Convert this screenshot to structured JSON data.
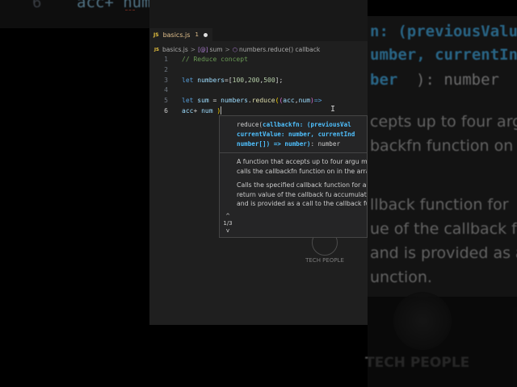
{
  "background": {
    "top_left_fragment": "acc+ num",
    "top_left_digit": "6",
    "top_right_fragment": "n: (previousValu",
    "line2": "umber, currentInd",
    "line3_param": "ber",
    "line3_rest": "): number",
    "prose": [
      "cepts up to four argu",
      "backfn function on",
      "llback function for",
      "ue of the callback fu",
      "and is provided as a",
      "unction."
    ],
    "brand": "TECH PEOPLE"
  },
  "tab": {
    "badge": "JS",
    "filename": "basics.js",
    "problem_count": "1"
  },
  "breadcrumb": {
    "file_badge": "JS",
    "file": "basics.js",
    "symbol_glyph": "[@]",
    "symbol": "sum",
    "method": "numbers.reduce() callback"
  },
  "code_lines": [
    {
      "n": "1",
      "parts": [
        {
          "c": "cm",
          "t": "// Reduce concept"
        }
      ]
    },
    {
      "n": "2",
      "parts": []
    },
    {
      "n": "3",
      "parts": [
        {
          "c": "kw",
          "t": "let "
        },
        {
          "c": "var",
          "t": "numbers"
        },
        {
          "c": "pl",
          "t": "=["
        },
        {
          "c": "num",
          "t": "100"
        },
        {
          "c": "pl",
          "t": ","
        },
        {
          "c": "num",
          "t": "200"
        },
        {
          "c": "pl",
          "t": ","
        },
        {
          "c": "num",
          "t": "500"
        },
        {
          "c": "pl",
          "t": "];"
        }
      ]
    },
    {
      "n": "4",
      "parts": []
    },
    {
      "n": "5",
      "parts": [
        {
          "c": "kw",
          "t": "let "
        },
        {
          "c": "var",
          "t": "sum"
        },
        {
          "c": "pl",
          "t": " = "
        },
        {
          "c": "var",
          "t": "numbers"
        },
        {
          "c": "pl",
          "t": "."
        },
        {
          "c": "fn",
          "t": "reduce"
        },
        {
          "c": "br",
          "t": "("
        },
        {
          "c": "br2",
          "t": "("
        },
        {
          "c": "var",
          "t": "acc"
        },
        {
          "c": "pl",
          "t": ","
        },
        {
          "c": "var",
          "t": "num"
        },
        {
          "c": "br2",
          "t": ")"
        },
        {
          "c": "arrow",
          "t": "=>"
        }
      ]
    },
    {
      "n": "6",
      "active": true,
      "parts": [
        {
          "c": "var",
          "t": "acc"
        },
        {
          "c": "pl",
          "t": "+ "
        },
        {
          "c": "var",
          "t": "num "
        },
        {
          "c": "br",
          "t": ")"
        }
      ]
    }
  ],
  "popup": {
    "sig_line1_a": "reduce(",
    "sig_line1_b": "callbackfn: (previousVal",
    "sig_line2": "currentValue: number, currentInd",
    "sig_line3_a": "number[]) => number)",
    "sig_line3_b": ": number",
    "doc1": "A function that accepts up to four argu method calls the callbackfn function on in the array.",
    "doc2": "Calls the specified callback function for array. The return value of the callback fu accumulated result, and is provided as a call to the callback function.",
    "pager_up": "^",
    "pager_count": "1/3",
    "pager_down": "v"
  },
  "watermark": "TECH PEOPLE",
  "colors": {
    "comment": "#6a9955",
    "keyword": "#569cd6",
    "variable": "#9cdcfe",
    "function": "#dcdcaa",
    "number": "#b5cea8",
    "highlight": "#4fc1ff"
  }
}
